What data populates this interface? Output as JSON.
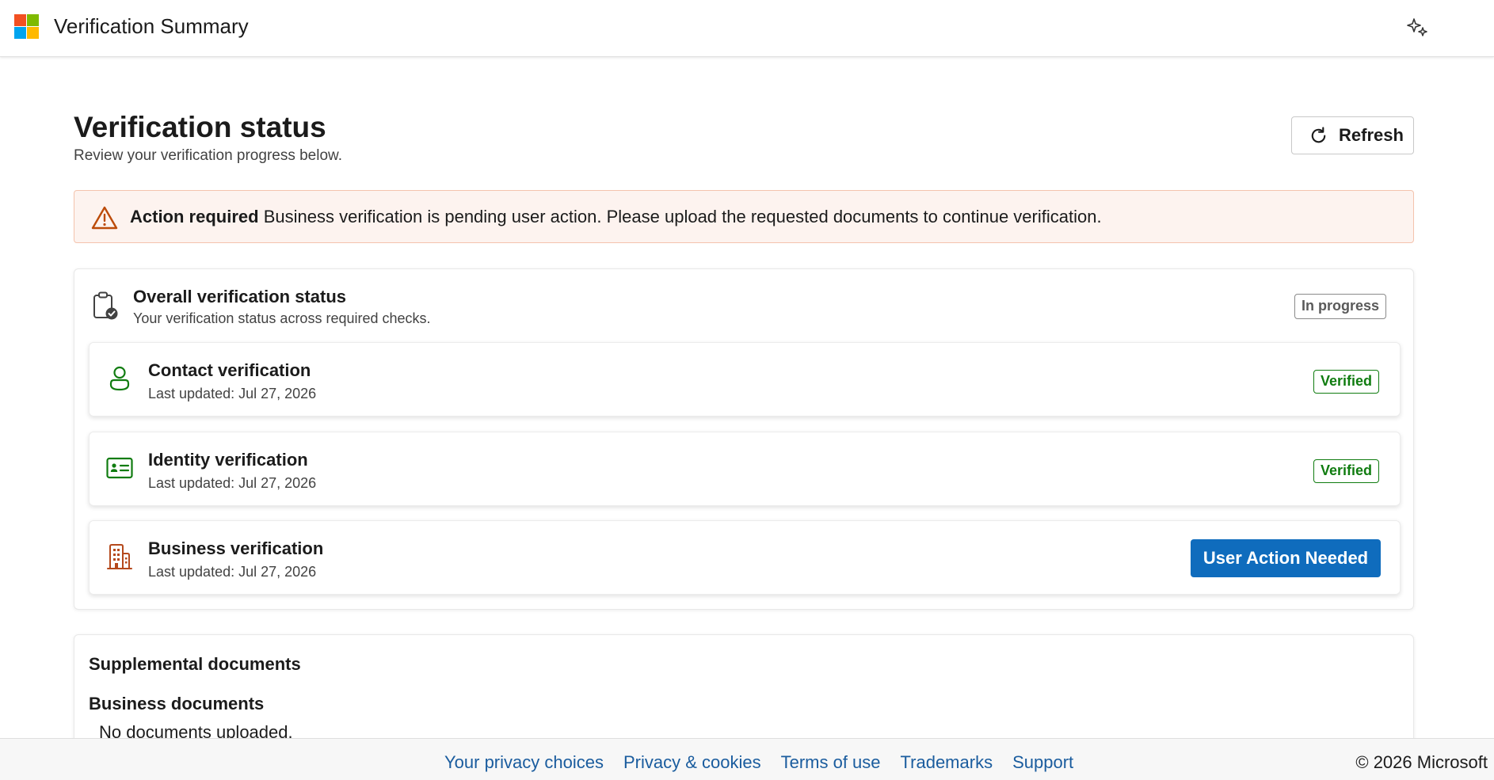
{
  "header": {
    "app_title": "Verification Summary",
    "logo": "microsoft-logo",
    "logo_colors": [
      "#f25022",
      "#7fba00",
      "#00a4ef",
      "#ffb900"
    ],
    "right_icon": "copilot-sparkle-icon"
  },
  "page": {
    "title": "Verification status",
    "subtitle": "Review your verification progress below.",
    "refresh_label": "Refresh"
  },
  "alert": {
    "icon": "warning-icon",
    "strong": "Action required",
    "message": "Business verification is pending user action. Please upload the requested documents to continue verification.",
    "color": "#bc4b09"
  },
  "overall": {
    "icon": "clipboard-check-icon",
    "title": "Overall verification status",
    "subtitle": "Your verification status across required checks.",
    "badge": "In progress"
  },
  "checks": [
    {
      "icon": "person-icon",
      "title": "Contact verification",
      "updated": "Last updated: Jul 27, 2026",
      "status": "Verified",
      "color": "#107c10"
    },
    {
      "icon": "id-card-icon",
      "title": "Identity verification",
      "updated": "Last updated: Jul 27, 2026",
      "status": "Verified",
      "color": "#107c10"
    },
    {
      "icon": "building-icon",
      "title": "Business verification",
      "updated": "Last updated: Jul 27, 2026",
      "action_label": "User Action Needed",
      "color": "#b5491c"
    }
  ],
  "supplemental": {
    "title": "Supplemental documents",
    "section": "Business documents",
    "empty": "No documents uploaded."
  },
  "footer": {
    "links": [
      "Your privacy choices",
      "Privacy & cookies",
      "Terms of use",
      "Trademarks",
      "Support"
    ],
    "copyright": "© 2026 Microsoft"
  },
  "colors": {
    "accent": "#0f6cbd",
    "success": "#107c10",
    "alert_bg": "#fdf3ef",
    "alert_border": "#f4c3ad"
  }
}
